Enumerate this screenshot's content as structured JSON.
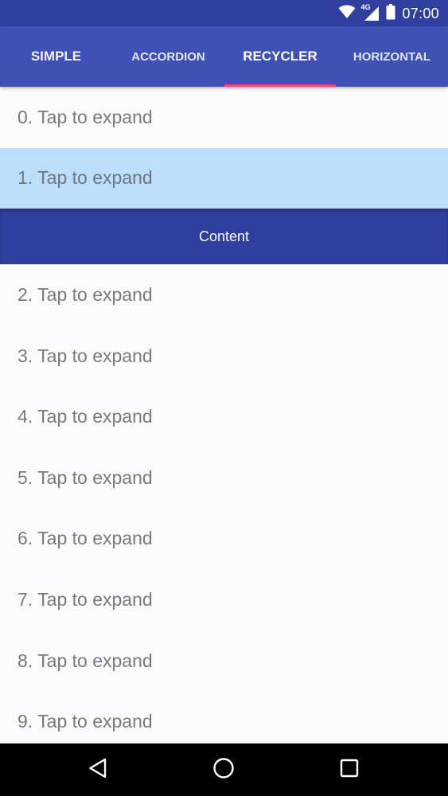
{
  "status_bar": {
    "time": "07:00",
    "network": "4G",
    "icons": [
      "wifi-icon",
      "cell-signal-icon",
      "battery-icon"
    ]
  },
  "tabs": [
    {
      "label": "SIMPLE",
      "selected": false
    },
    {
      "label": "ACCORDION",
      "selected": false
    },
    {
      "label": "RECYCLER",
      "selected": true
    },
    {
      "label": "HORIZONTAL",
      "selected": false
    }
  ],
  "list": {
    "items": [
      {
        "label": "0. Tap to expand"
      },
      {
        "label": "1. Tap to expand",
        "expanded": true
      },
      {
        "label": "2. Tap to expand"
      },
      {
        "label": "3. Tap to expand"
      },
      {
        "label": "4. Tap to expand"
      },
      {
        "label": "5. Tap to expand"
      },
      {
        "label": "6. Tap to expand"
      },
      {
        "label": "7. Tap to expand"
      },
      {
        "label": "8. Tap to expand"
      },
      {
        "label": "9. Tap to expand"
      }
    ],
    "expanded_content": "Content"
  },
  "colors": {
    "status_bar": "#303f9f",
    "toolbar": "#3f51b5",
    "accent": "#ff4081",
    "expanded_row": "#bbdefb",
    "content_panel": "#303f9f"
  },
  "navigation_bar": {
    "icons": [
      "back-icon",
      "home-icon",
      "recents-icon"
    ]
  }
}
